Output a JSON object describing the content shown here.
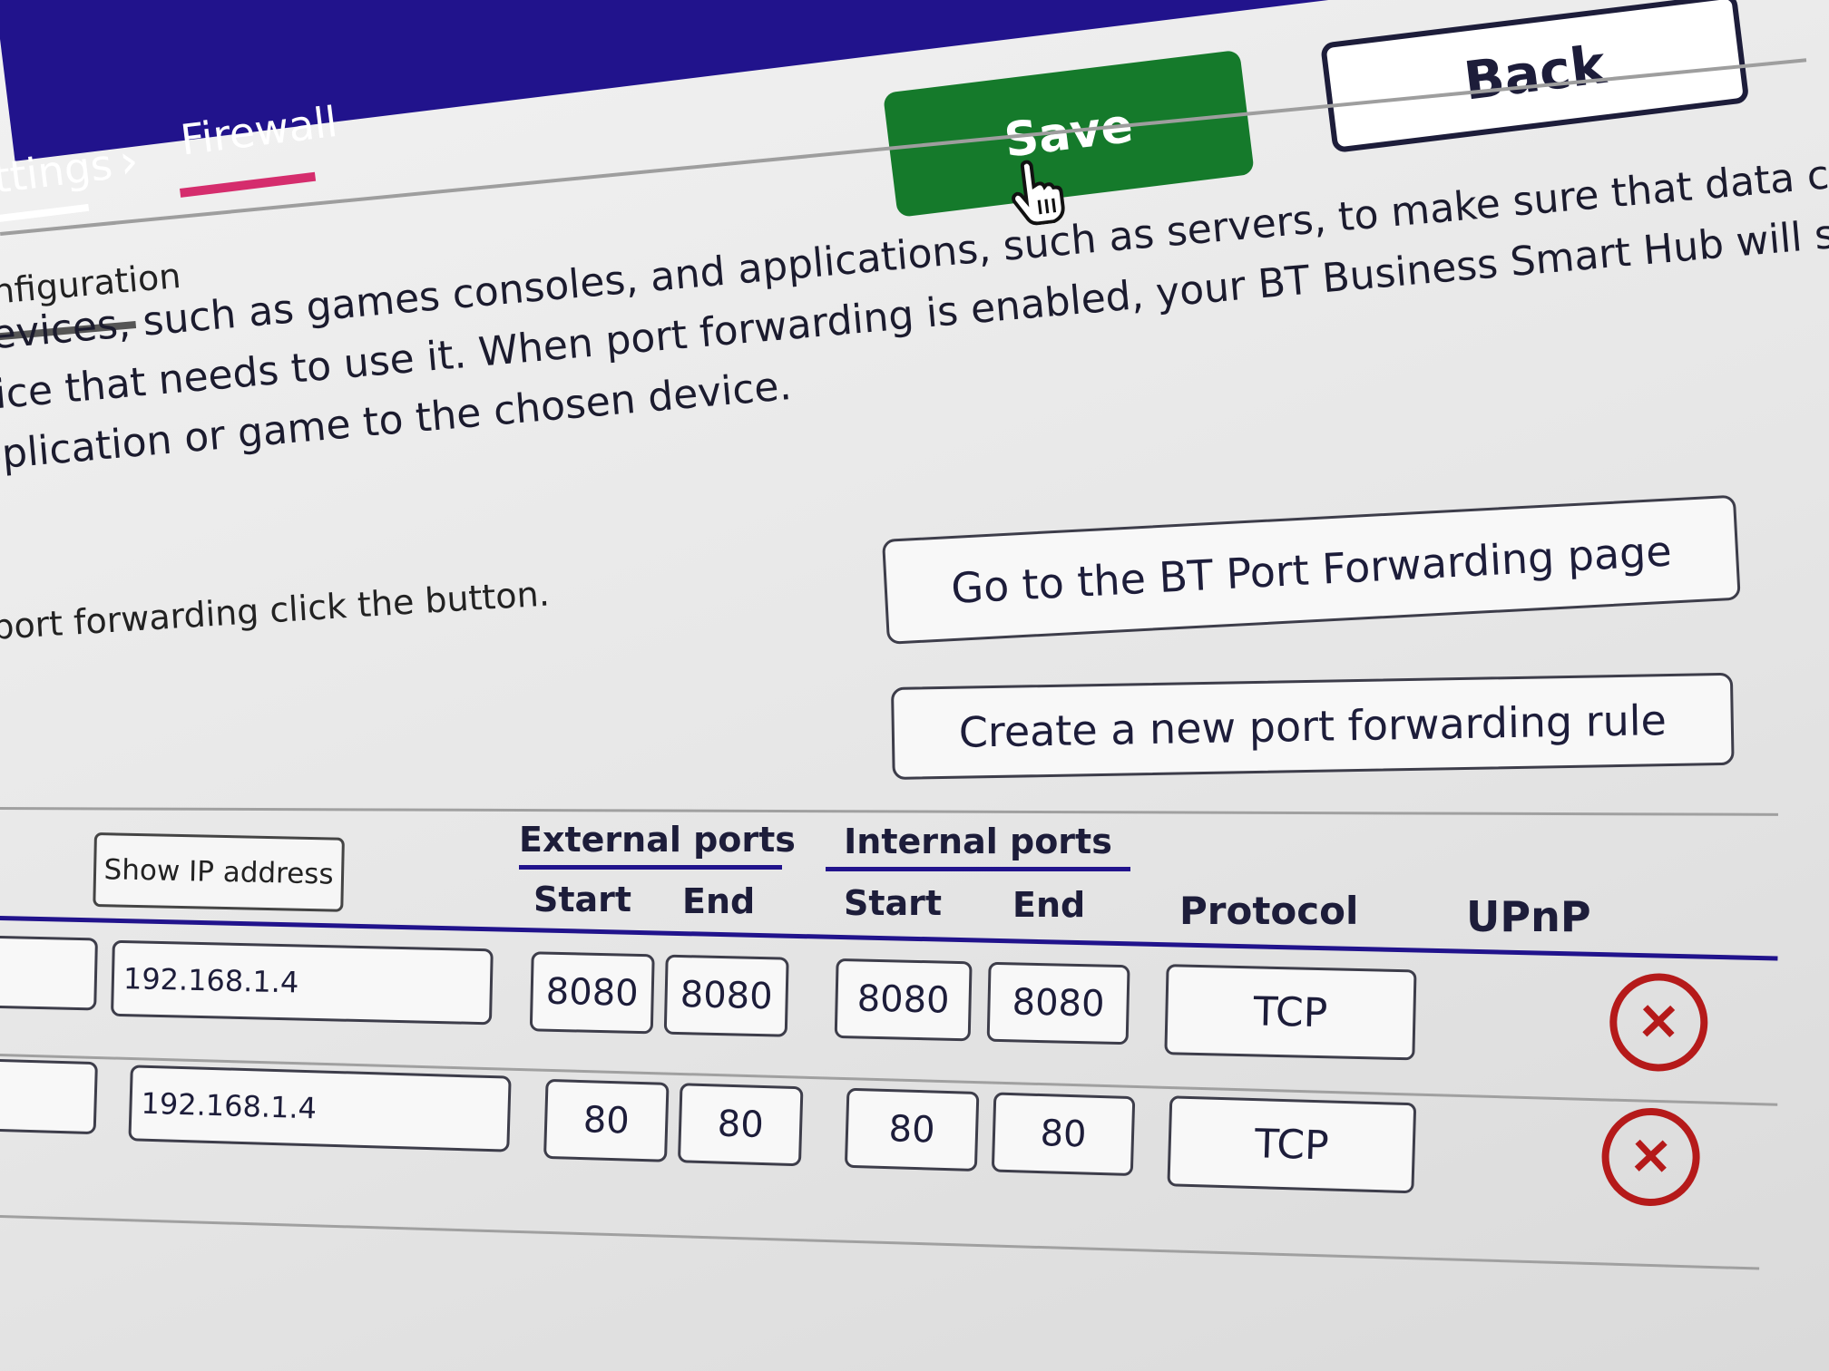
{
  "breadcrumb": {
    "parent": "ttings",
    "separator": "›",
    "current": "Firewall"
  },
  "toolbar": {
    "save_label": "Save",
    "back_label": "Back"
  },
  "subnav": {
    "active_tab": "nfiguration"
  },
  "description": {
    "lines": [
      "devices, such as games consoles, and applications, such as servers, to make sure that data coming from",
      "vice that needs to use it. When port forwarding is enabled, your BT Business Smart Hub will send all",
      "pplication or game to the chosen device."
    ],
    "hint": "port forwarding click the button."
  },
  "actions": {
    "goto_label": "Go to the BT Port Forwarding page",
    "create_label": "Create a new port forwarding rule"
  },
  "table": {
    "show_ip_label": "Show IP address",
    "external_ports": "External ports",
    "internal_ports": "Internal ports",
    "start": "Start",
    "end": "End",
    "protocol": "Protocol",
    "upnp": "UPnP",
    "rows": [
      {
        "ip": "192.168.1.4",
        "ext_start": "8080",
        "ext_end": "8080",
        "int_start": "8080",
        "int_end": "8080",
        "protocol": "TCP"
      },
      {
        "ip": "192.168.1.4",
        "ext_start": "80",
        "ext_end": "80",
        "int_start": "80",
        "int_end": "80",
        "protocol": "TCP"
      }
    ]
  },
  "colors": {
    "header": "#21138c",
    "save": "#157a2b",
    "accent_pink": "#d52d6d",
    "delete": "#b51a1a"
  },
  "icons": {
    "separator": "chevron-right-icon",
    "cursor": "hand-pointer-icon",
    "delete": "close-circle-icon"
  }
}
